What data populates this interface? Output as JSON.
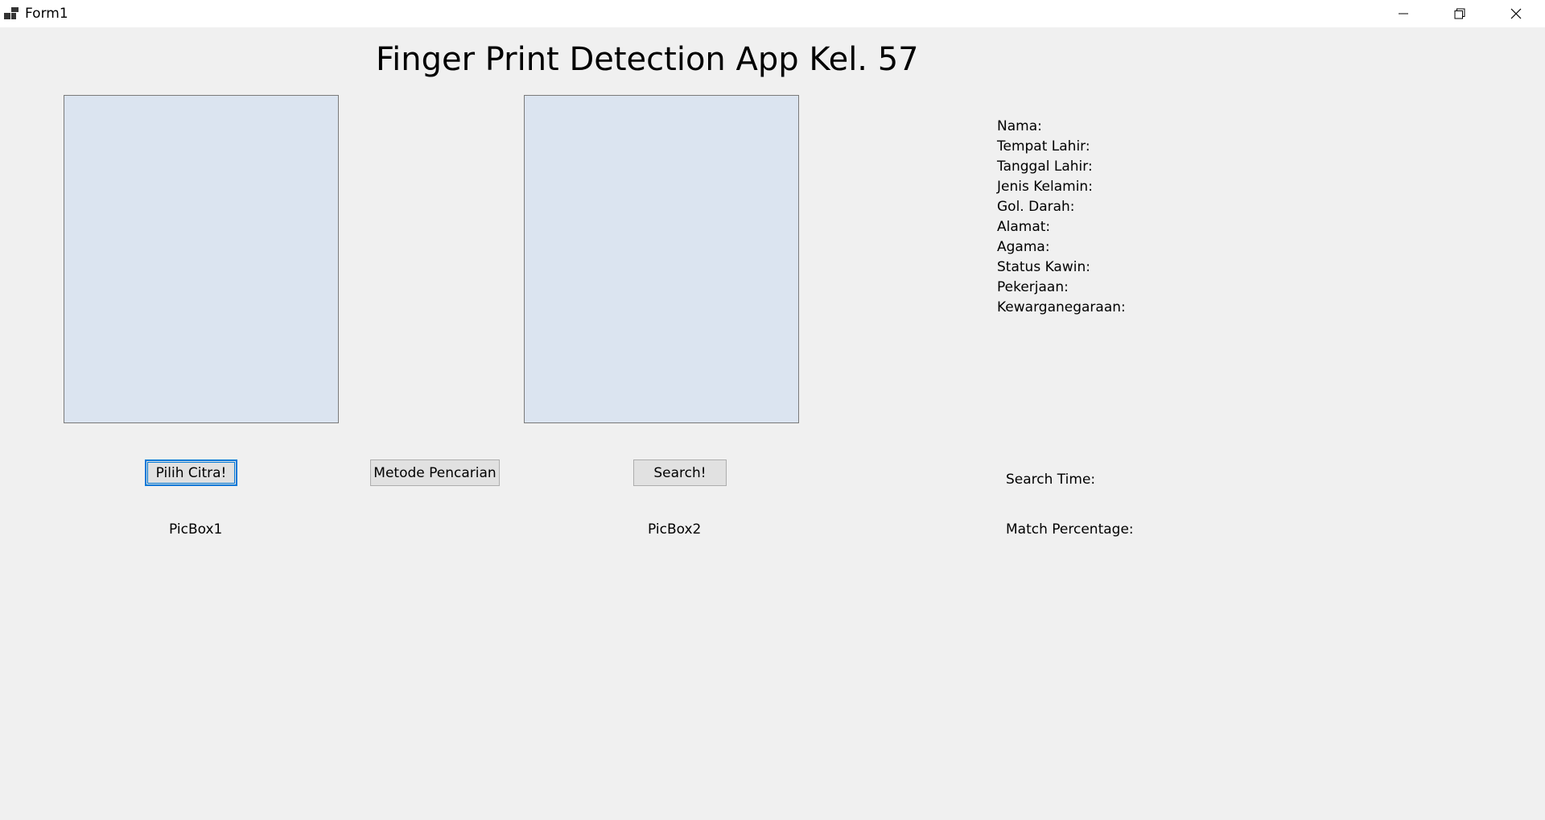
{
  "window": {
    "title": "Form1"
  },
  "header": {
    "title": "Finger Print Detection App Kel. 57"
  },
  "buttons": {
    "pilih_citra": "Pilih Citra!",
    "metode_pencarian": "Metode Pencarian",
    "search": "Search!"
  },
  "labels": {
    "picbox1": "PicBox1",
    "picbox2": "PicBox2",
    "search_time": "Search Time:",
    "match_percentage": "Match Percentage:"
  },
  "info_fields": [
    "Nama:",
    "Tempat Lahir:",
    "Tanggal Lahir:",
    "Jenis Kelamin:",
    "Gol. Darah:",
    "Alamat:",
    "Agama:",
    "Status Kawin:",
    "Pekerjaan:",
    "Kewarganegaraan:"
  ],
  "colors": {
    "window_bg": "#f0f0f0",
    "picbox_bg": "#dbe4f0",
    "focus_accent": "#0078d7"
  }
}
